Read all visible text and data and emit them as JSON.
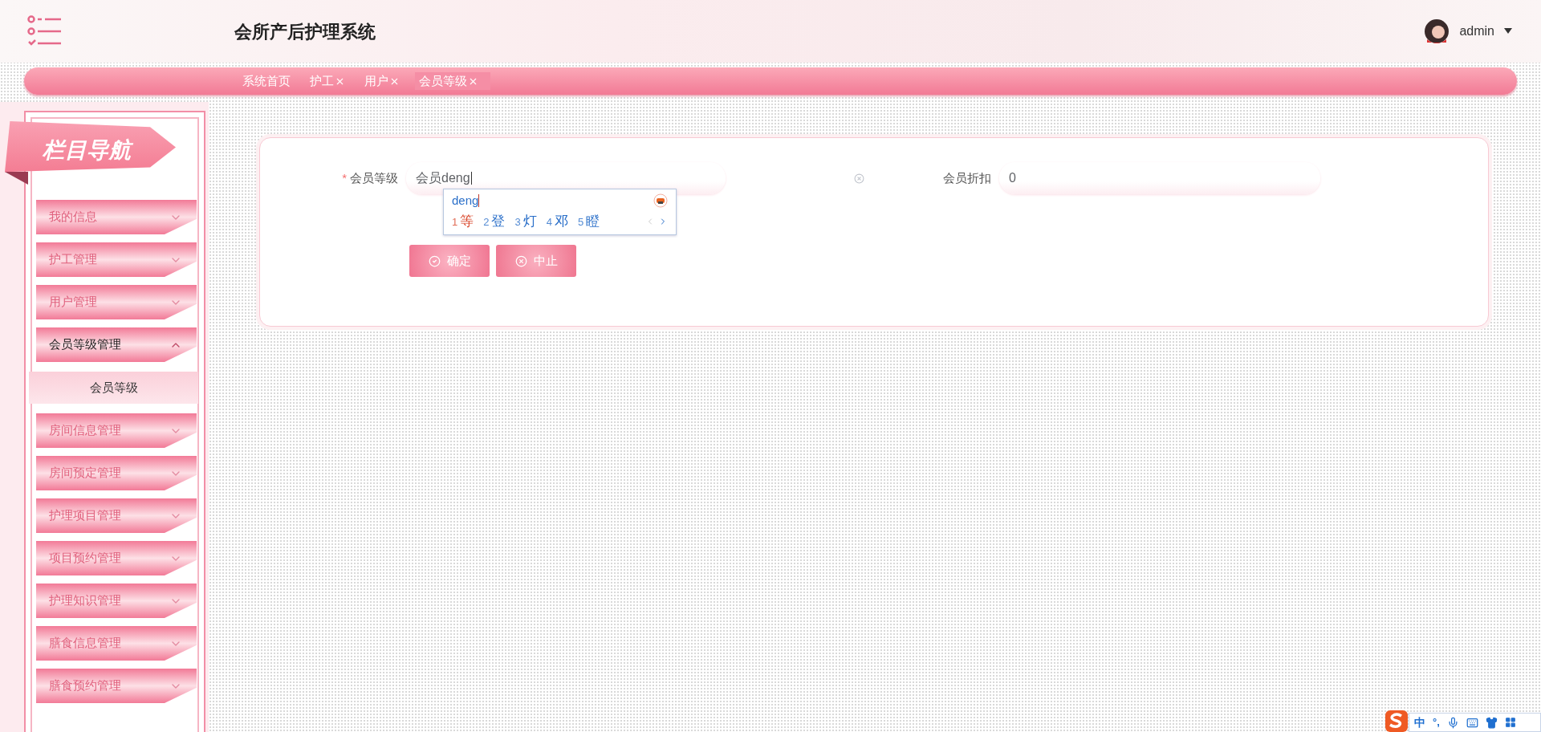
{
  "header": {
    "title": "会所产后护理系统",
    "user": {
      "name": "admin"
    }
  },
  "tabs": [
    {
      "label": "系统首页",
      "closable": false,
      "selected": false
    },
    {
      "label": "护工",
      "closable": true,
      "selected": false
    },
    {
      "label": "用户",
      "closable": true,
      "selected": false
    },
    {
      "label": "会员等级",
      "closable": true,
      "selected": true
    }
  ],
  "sidebar": {
    "title": "栏目导航",
    "items": [
      {
        "label": "我的信息",
        "expanded": false
      },
      {
        "label": "护工管理",
        "expanded": false
      },
      {
        "label": "用户管理",
        "expanded": false
      },
      {
        "label": "会员等级管理",
        "expanded": true,
        "children": [
          {
            "label": "会员等级",
            "selected": true
          }
        ]
      },
      {
        "label": "房间信息管理",
        "expanded": false
      },
      {
        "label": "房间预定管理",
        "expanded": false
      },
      {
        "label": "护理项目管理",
        "expanded": false
      },
      {
        "label": "项目预约管理",
        "expanded": false
      },
      {
        "label": "护理知识管理",
        "expanded": false
      },
      {
        "label": "膳食信息管理",
        "expanded": false
      },
      {
        "label": "膳食预约管理",
        "expanded": false
      }
    ]
  },
  "form": {
    "fields": [
      {
        "label": "会员等级",
        "required_mark": "*",
        "value": "会员deng",
        "clearable": true
      },
      {
        "label": "会员折扣",
        "value": "0",
        "clearable": false
      }
    ],
    "buttons": [
      {
        "label": "确定",
        "kind": "confirm"
      },
      {
        "label": "中止",
        "kind": "cancel"
      }
    ]
  },
  "ime_popup": {
    "composition": "deng",
    "candidates": [
      {
        "index": "1",
        "text": "等",
        "selected": true
      },
      {
        "index": "2",
        "text": "登",
        "selected": false
      },
      {
        "index": "3",
        "text": "灯",
        "selected": false
      },
      {
        "index": "4",
        "text": "邓",
        "selected": false
      },
      {
        "index": "5",
        "text": "瞪",
        "selected": false
      }
    ]
  },
  "ime_toolbar": {
    "mode": "中",
    "punctuation": "°,"
  }
}
